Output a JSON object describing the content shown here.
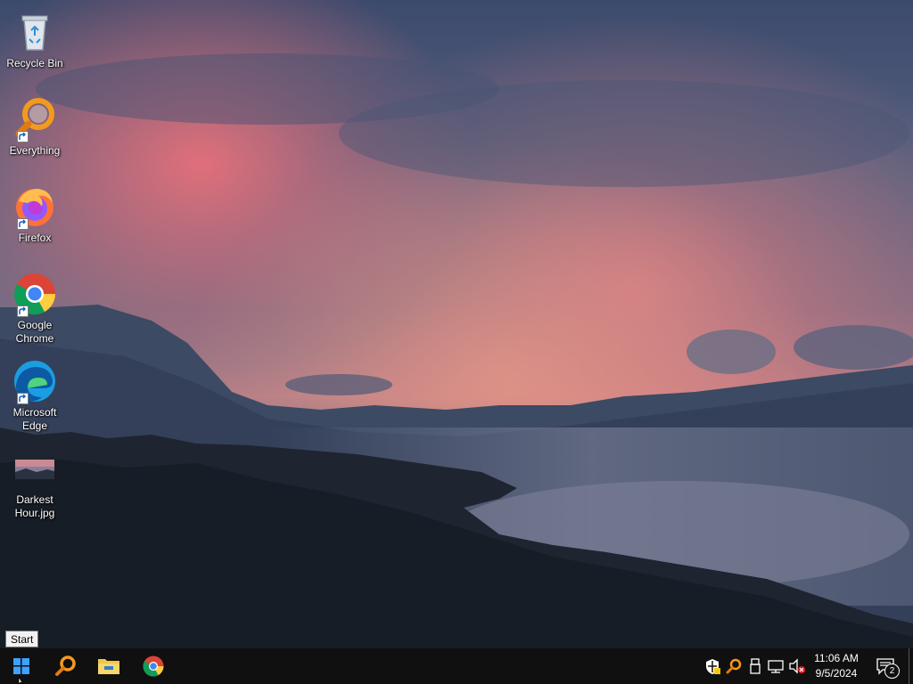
{
  "desktop": {
    "icons": [
      {
        "label": "Recycle Bin",
        "icon": "recycle-bin-icon",
        "shortcut": false
      },
      {
        "label": "Everything",
        "icon": "everything-search-icon",
        "shortcut": true
      },
      {
        "label": "Firefox",
        "icon": "firefox-icon",
        "shortcut": true
      },
      {
        "label": "Google\nChrome",
        "icon": "chrome-icon",
        "shortcut": true
      },
      {
        "label": "Microsoft\nEdge",
        "icon": "edge-icon",
        "shortcut": true
      },
      {
        "label": "Darkest\nHour.jpg",
        "icon": "image-thumbnail-icon",
        "shortcut": false
      }
    ]
  },
  "tooltip": {
    "start": "Start"
  },
  "taskbar": {
    "buttons": [
      {
        "name": "Start",
        "icon": "windows-logo-icon"
      },
      {
        "name": "Everything",
        "icon": "everything-search-icon"
      },
      {
        "name": "File Explorer",
        "icon": "folder-icon"
      },
      {
        "name": "Google Chrome",
        "icon": "chrome-icon"
      }
    ],
    "tray": {
      "icons": [
        "windows-security-icon",
        "everything-tray-icon",
        "usb-device-icon",
        "network-icon",
        "volume-muted-icon"
      ],
      "time": "11:06 AM",
      "date": "9/5/2024",
      "notification_count": "2"
    }
  },
  "colors": {
    "taskbar_bg": "#101010",
    "accent_blue": "#0078d7",
    "sky_pink": "#e0707a"
  }
}
